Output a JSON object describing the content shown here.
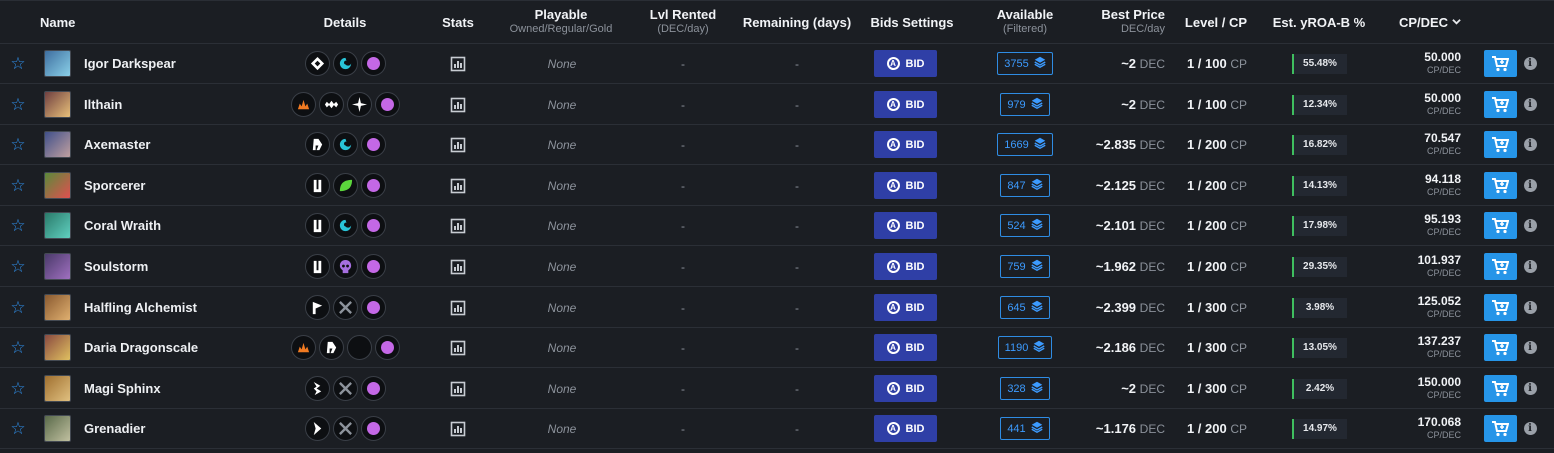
{
  "headers": {
    "name": "Name",
    "details": "Details",
    "stats": "Stats",
    "playable": "Playable",
    "playable_sub": "Owned/Regular/Gold",
    "lvl_rented": "Lvl Rented",
    "lvl_rented_sub": "(DEC/day)",
    "remaining": "Remaining (days)",
    "bids_settings": "Bids Settings",
    "available": "Available",
    "available_sub": "(Filtered)",
    "best_price": "Best Price",
    "best_price_sub": "DEC/day",
    "level_cp": "Level / CP",
    "yroa": "Est. yROA-B %",
    "cp_dec": "CP/DEC",
    "cp_dec_sort_icon": "chevron-down-icon"
  },
  "labels": {
    "bid": "BID",
    "cp_unit": "CP",
    "dec_unit": "DEC",
    "cp_dec_unit": "CP/DEC",
    "info": "i"
  },
  "colors": {
    "accent_blue": "#2f8ce3",
    "bid_button": "#2f3fa6",
    "cart_button": "#2695e8",
    "yroa_bar": "#3fbf5f",
    "mana_purple": "#c468e6"
  },
  "rows": [
    {
      "name": "Igor Darkspear",
      "thumb_colors": [
        "#3f6fa0",
        "#8ad0e8"
      ],
      "details": [
        "diamond-icon",
        "swirl-icon",
        "mana-dot"
      ],
      "playable": "None",
      "lvl_rented": "-",
      "remaining": "-",
      "available": "3755",
      "best_price": "~2",
      "level_cp": "1 / 100",
      "yroa": "55.48%",
      "cp_dec": "50.000"
    },
    {
      "name": "Ilthain",
      "thumb_colors": [
        "#6f3f40",
        "#e8c07a"
      ],
      "details": [
        "flame-icon",
        "wings-icon",
        "sparkle-icon",
        "mana-dot"
      ],
      "playable": "None",
      "lvl_rented": "-",
      "remaining": "-",
      "available": "979",
      "best_price": "~2",
      "level_cp": "1 / 100",
      "yroa": "12.34%",
      "cp_dec": "50.000"
    },
    {
      "name": "Axemaster",
      "thumb_colors": [
        "#40508a",
        "#c0a0a0"
      ],
      "details": [
        "arrow-r-icon",
        "swirl-icon",
        "mana-dot"
      ],
      "playable": "None",
      "lvl_rented": "-",
      "remaining": "-",
      "available": "1669",
      "best_price": "~2.835",
      "level_cp": "1 / 200",
      "yroa": "16.82%",
      "cp_dec": "70.547"
    },
    {
      "name": "Sporcerer",
      "thumb_colors": [
        "#5a8a3a",
        "#e05050"
      ],
      "details": [
        "u-icon",
        "leaf-icon",
        "mana-dot"
      ],
      "playable": "None",
      "lvl_rented": "-",
      "remaining": "-",
      "available": "847",
      "best_price": "~2.125",
      "level_cp": "1 / 200",
      "yroa": "14.13%",
      "cp_dec": "94.118"
    },
    {
      "name": "Coral Wraith",
      "thumb_colors": [
        "#2a7a6a",
        "#60d0c0"
      ],
      "details": [
        "u-icon",
        "swirl-icon",
        "mana-dot"
      ],
      "playable": "None",
      "lvl_rented": "-",
      "remaining": "-",
      "available": "524",
      "best_price": "~2.101",
      "level_cp": "1 / 200",
      "yroa": "17.98%",
      "cp_dec": "95.193"
    },
    {
      "name": "Soulstorm",
      "thumb_colors": [
        "#4a3a6a",
        "#a070c0"
      ],
      "details": [
        "u-icon",
        "skull-icon",
        "mana-dot"
      ],
      "playable": "None",
      "lvl_rented": "-",
      "remaining": "-",
      "available": "759",
      "best_price": "~1.962",
      "level_cp": "1 / 200",
      "yroa": "29.35%",
      "cp_dec": "101.937"
    },
    {
      "name": "Halfling Alchemist",
      "thumb_colors": [
        "#8a5a30",
        "#e0b070"
      ],
      "details": [
        "flag-icon",
        "swords-icon",
        "mana-dot"
      ],
      "playable": "None",
      "lvl_rented": "-",
      "remaining": "-",
      "available": "645",
      "best_price": "~2.399",
      "level_cp": "1 / 300",
      "yroa": "3.98%",
      "cp_dec": "125.052"
    },
    {
      "name": "Daria Dragonscale",
      "thumb_colors": [
        "#8a4a40",
        "#e0c060"
      ],
      "details": [
        "flame-icon",
        "arrow-r-icon",
        "crescent-icon",
        "mana-dot"
      ],
      "playable": "None",
      "lvl_rented": "-",
      "remaining": "-",
      "available": "1190",
      "best_price": "~2.186",
      "level_cp": "1 / 300",
      "yroa": "13.05%",
      "cp_dec": "137.237"
    },
    {
      "name": "Magi Sphinx",
      "thumb_colors": [
        "#a07030",
        "#e0c080"
      ],
      "details": [
        "bolt-icon",
        "swords-icon",
        "mana-dot"
      ],
      "playable": "None",
      "lvl_rented": "-",
      "remaining": "-",
      "available": "328",
      "best_price": "~2",
      "level_cp": "1 / 300",
      "yroa": "2.42%",
      "cp_dec": "150.000"
    },
    {
      "name": "Grenadier",
      "thumb_colors": [
        "#5a6a4a",
        "#c0c0a0"
      ],
      "details": [
        "chevron-icon",
        "swords-icon",
        "mana-dot"
      ],
      "playable": "None",
      "lvl_rented": "-",
      "remaining": "-",
      "available": "441",
      "best_price": "~1.176",
      "level_cp": "1 / 200",
      "yroa": "14.97%",
      "cp_dec": "170.068"
    }
  ]
}
